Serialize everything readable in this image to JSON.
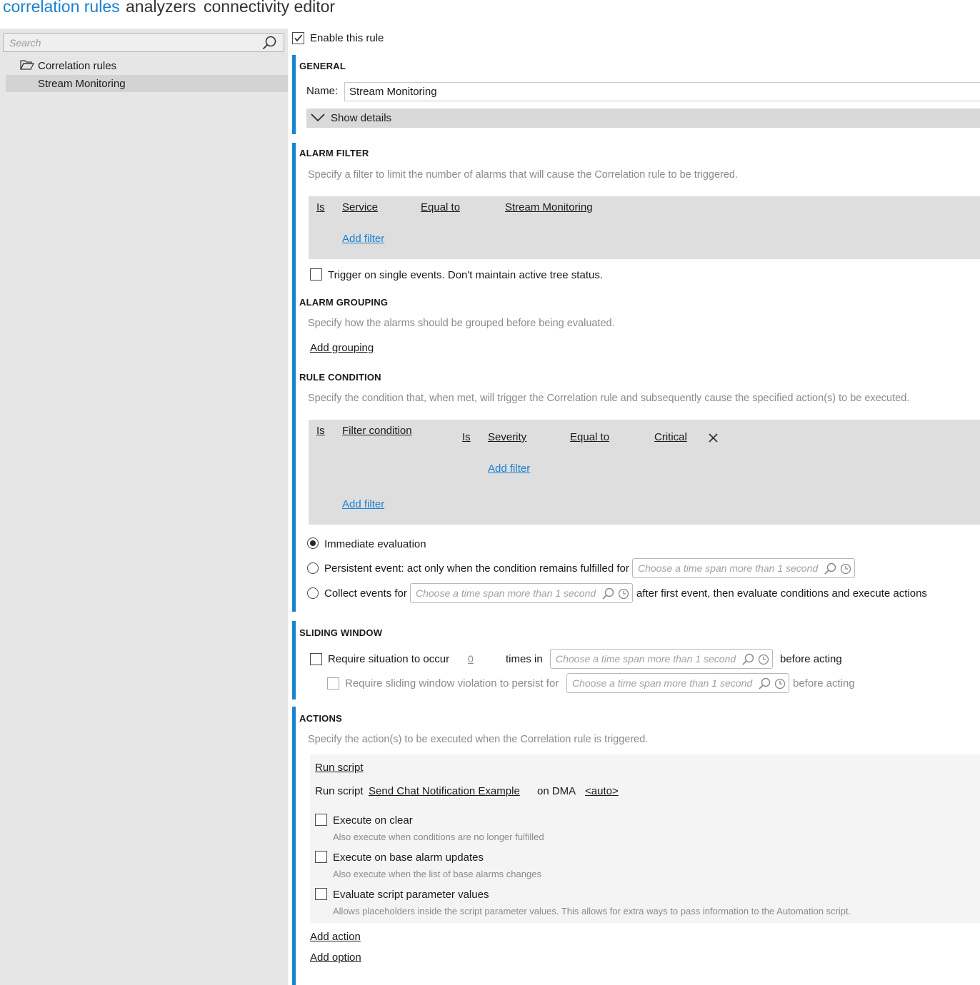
{
  "top_nav": {
    "correlation_rules": "correlation rules",
    "analyzers": "analyzers",
    "connectivity_editor": "connectivity editor"
  },
  "sidebar": {
    "search_placeholder": "Search",
    "tree_root": "Correlation rules",
    "tree_item": "Stream Monitoring"
  },
  "rule": {
    "enable_label": "Enable this rule",
    "enabled": true
  },
  "general": {
    "title": "GENERAL",
    "name_label": "Name:",
    "name_value": "Stream Monitoring",
    "show_details": "Show details"
  },
  "alarm_filter": {
    "title": "ALARM FILTER",
    "hint": "Specify a filter to limit the number of alarms that will cause the Correlation rule to be triggered.",
    "row": {
      "is": "Is",
      "field": "Service",
      "op": "Equal to",
      "value": "Stream Monitoring"
    },
    "add_filter": "Add filter",
    "trigger_single": "Trigger on single events. Don't maintain active tree status."
  },
  "alarm_grouping": {
    "title": "ALARM GROUPING",
    "hint": "Specify how the alarms should be grouped before being evaluated.",
    "add_grouping": "Add grouping"
  },
  "rule_condition": {
    "title": "RULE CONDITION",
    "hint": "Specify the condition that, when met, will trigger the Correlation rule and subsequently cause the specified action(s) to be executed.",
    "outer_is": "Is",
    "filter_condition": "Filter condition",
    "inner": {
      "is": "Is",
      "field": "Severity",
      "op": "Equal to",
      "value": "Critical"
    },
    "inner_add_filter": "Add filter",
    "outer_add_filter": "Add filter",
    "immediate": "Immediate evaluation",
    "persistent": "Persistent event: act only when the condition remains fulfilled for",
    "collect": "Collect events for",
    "collect_after": "after first event, then evaluate conditions and execute actions",
    "timespan_placeholder": "Choose a time span more than 1 second"
  },
  "sliding_window": {
    "title": "SLIDING WINDOW",
    "require_label": "Require situation to occur",
    "count": "0",
    "times_in": "times in",
    "before_acting": "before acting",
    "persist_label": "Require sliding window violation to persist for",
    "before_acting_2": "before acting",
    "timespan_placeholder": "Choose a time span more than 1 second"
  },
  "actions": {
    "title": "ACTIONS",
    "hint": "Specify the action(s) to be executed when the Correlation rule is triggered.",
    "run_script_header": "Run script",
    "run_script_label": "Run script",
    "script_name": "Send Chat Notification Example",
    "on_dma": "on DMA",
    "dma_value": "<auto>",
    "execute_on_clear": "Execute on clear",
    "execute_on_clear_hint": "Also execute when conditions are no longer fulfilled",
    "execute_on_base": "Execute on base alarm updates",
    "execute_on_base_hint": "Also execute when the list of base alarms changes",
    "evaluate_params": "Evaluate script parameter values",
    "evaluate_params_hint": "Allows placeholders inside the script parameter values. This allows for extra ways to pass information to the Automation script.",
    "add_action": "Add action",
    "add_option": "Add option"
  },
  "colors": {
    "accent": "#1b82d1",
    "panel": "#e6e6e6",
    "filter_box": "#dedede"
  }
}
